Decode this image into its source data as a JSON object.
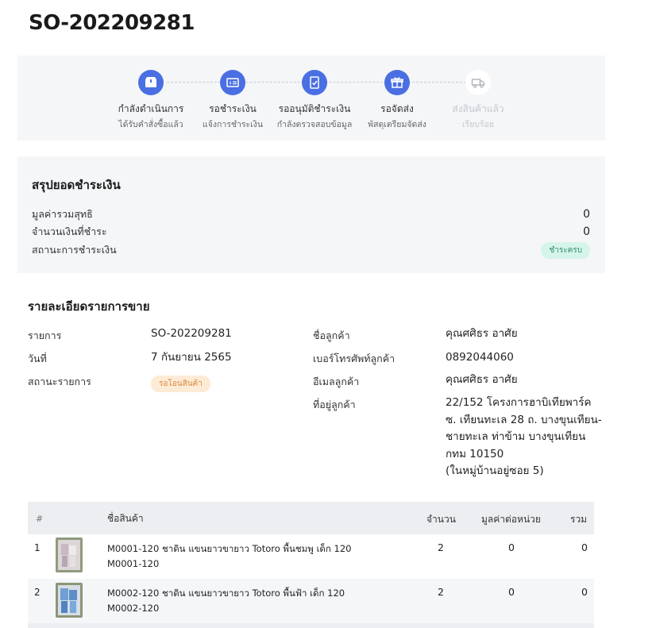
{
  "order": {
    "title": "SO-202209281"
  },
  "stepper": [
    {
      "label": "กำลังดำเนินการ",
      "sub": "ได้รับคำสั่งซื้อแล้ว",
      "icon": "box-icon",
      "active": true
    },
    {
      "label": "รอชำระเงิน",
      "sub": "แจ้งการชำระเงิน",
      "icon": "payment-icon",
      "active": true
    },
    {
      "label": "รออนุมัติชำระเงิน",
      "sub": "กำลังตรวจสอบข้อมูล",
      "icon": "document-check-icon",
      "active": true
    },
    {
      "label": "รอจัดส่ง",
      "sub": "พัสดุเตรียมจัดส่ง",
      "icon": "gift-icon",
      "active": true
    },
    {
      "label": "ส่งสินค้าแล้ว",
      "sub": "เรียบร้อย",
      "icon": "truck-icon",
      "active": false
    }
  ],
  "payment": {
    "title": "สรุปยอดชำระเงิน",
    "net_label": "มูลค่ารวมสุทธิ",
    "net_value": "0",
    "paid_label": "จำนวนเงินที่ชำระ",
    "paid_value": "0",
    "status_label": "สถานะการชำระเงิน",
    "status_value": "ชำระครบ"
  },
  "details": {
    "title": "รายละเอียดรายการขาย",
    "order_label": "รายการ",
    "order_value": "SO-202209281",
    "date_label": "วันที่",
    "date_value": "7 กันยายน 2565",
    "status_label": "สถานะรายการ",
    "status_value": "รอโอนสินค้า",
    "customer_label": "ชื่อลูกค้า",
    "customer_value": "คุณศศิธร อาศัย",
    "phone_label": "เบอร์โทรศัพท์ลูกค้า",
    "phone_value": "0892044060",
    "email_label": "อีเมลลูกค้า",
    "email_value": "คุณศศิธร อาศัย",
    "address_label": "ที่อยู่ลูกค้า",
    "address_lines": [
      "22/152 โครงการฮาบิเทียพาร์ค",
      "ซ. เทียนทะเล 28 ถ. บางขุนเทียน-",
      "ชายทะเล ท่าข้าม บางขุนเทียน",
      "กทม 10150",
      "(ในหมู่บ้านอยู่ซอย 5)"
    ]
  },
  "table": {
    "headers": {
      "index": "#",
      "name": "ชื่อสินค้า",
      "qty": "จำนวน",
      "unit_price": "มูลค่าต่อหน่วย",
      "total": "รวม"
    },
    "rows": [
      {
        "index": "1",
        "name": "M0001-120 ชาดิน แขนยาวขายาว Totoro พื้นชมพู เด็ก 120",
        "sku": "M0001-120",
        "qty": "2",
        "unit_price": "0",
        "total": "0",
        "thumb_color": "#c9b7c2"
      },
      {
        "index": "2",
        "name": "M0002-120 ชาดิน แขนยาวขายาว Totoro พื้นฟ้า เด็ก 120",
        "sku": "M0002-120",
        "qty": "2",
        "unit_price": "0",
        "total": "0",
        "thumb_color": "#6f9fd3"
      }
    ]
  }
}
